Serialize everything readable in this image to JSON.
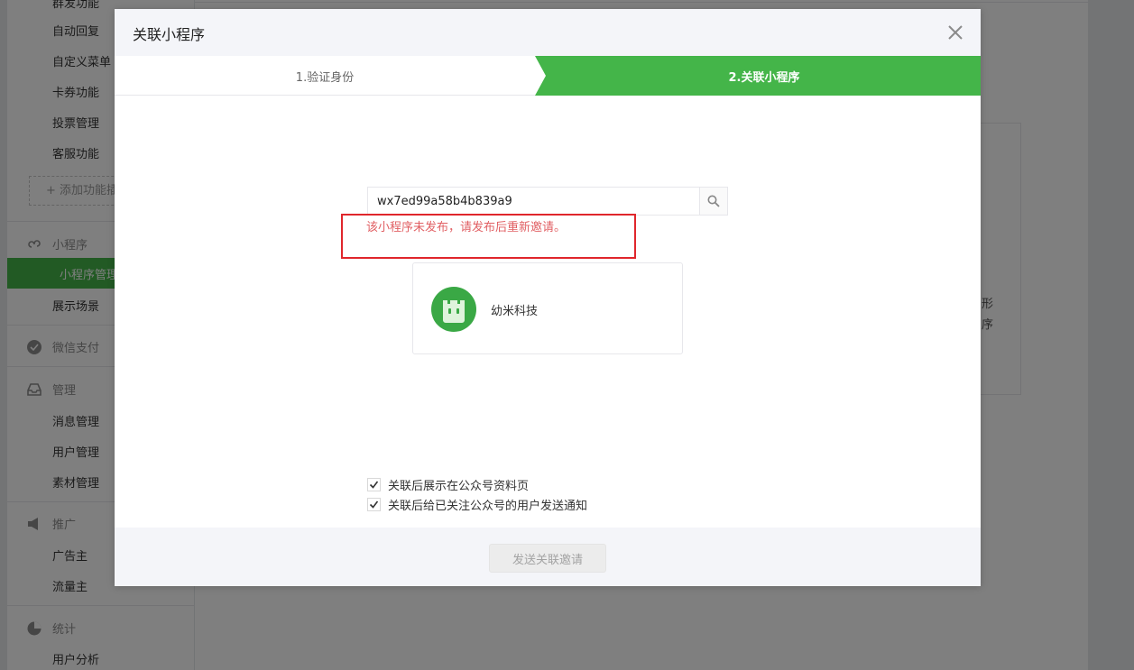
{
  "background": {
    "sidebar": {
      "top_items": [
        "群发功能",
        "自动回复",
        "自定义菜单",
        "卡券功能",
        "投票管理",
        "客服功能"
      ],
      "add_label": "+ 添加功能插件",
      "groups": [
        {
          "label": "小程序",
          "icon": "miniprogram-icon",
          "items": [
            "小程序管理",
            "展示场景"
          ]
        },
        {
          "label": "微信支付",
          "icon": "wechat-pay-icon",
          "items": []
        },
        {
          "label": "管理",
          "icon": "inbox-icon",
          "items": [
            "消息管理",
            "用户管理",
            "素材管理"
          ]
        },
        {
          "label": "推广",
          "icon": "megaphone-icon",
          "items": [
            "广告主",
            "流量主"
          ]
        },
        {
          "label": "统计",
          "icon": "pie-chart-icon",
          "items": [
            "用户分析"
          ]
        }
      ],
      "active_item": "小程序管理"
    },
    "content_card_text": [
      "形",
      "序"
    ]
  },
  "dialog": {
    "title": "关联小程序",
    "steps": [
      {
        "label": "1.验证身份",
        "active": false
      },
      {
        "label": "2.关联小程序",
        "active": true
      }
    ],
    "search": {
      "value": "wx7ed99a58b4b839a9",
      "placeholder": ""
    },
    "error_message": "该小程序未发布，请发布后重新邀请。",
    "result": {
      "name": "幼米科技",
      "icon": "green-robot-avatar"
    },
    "options": [
      {
        "label": "关联后展示在公众号资料页",
        "checked": true
      },
      {
        "label": "关联后给已关注公众号的用户发送通知",
        "checked": true
      }
    ],
    "submit_label": "发送关联邀请"
  },
  "colors": {
    "accent": "#44b549",
    "error": "#e15f63",
    "highlight": "#e0262c"
  }
}
